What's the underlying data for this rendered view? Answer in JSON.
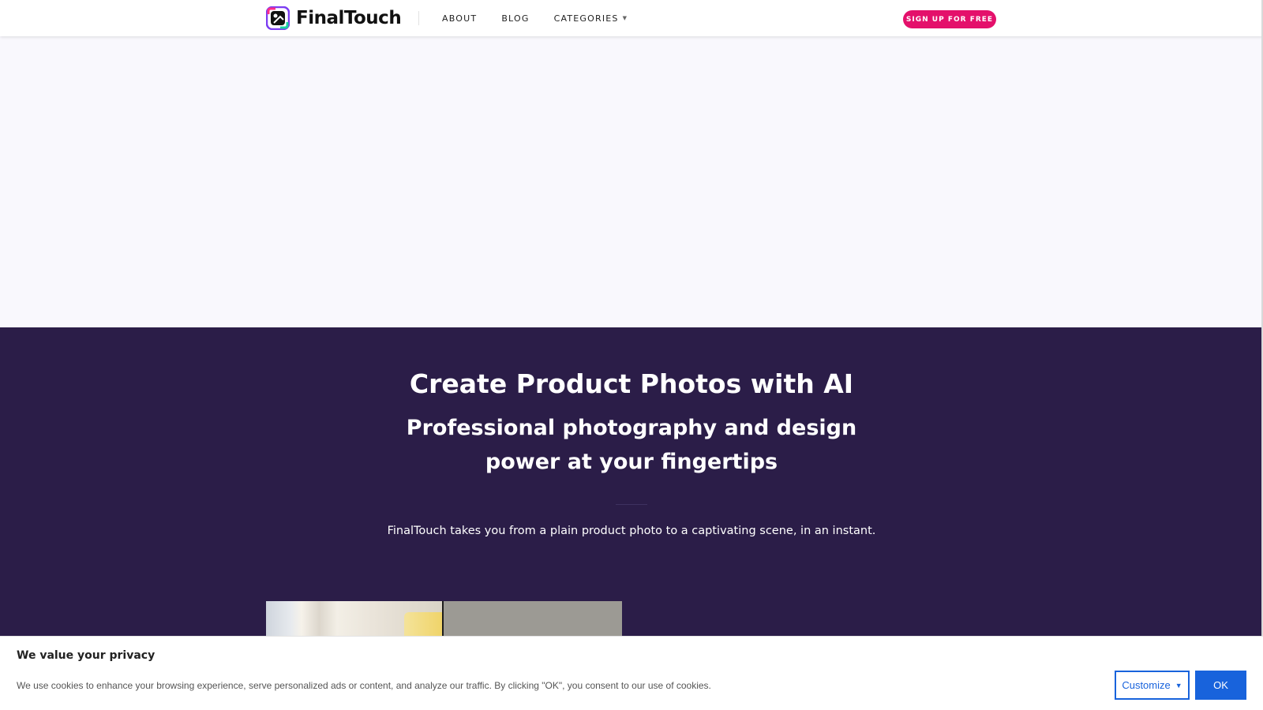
{
  "header": {
    "logo_text": "FinalTouch",
    "nav": [
      {
        "label": "ABOUT"
      },
      {
        "label": "BLOG"
      },
      {
        "label": "CATEGORIES"
      }
    ],
    "signup_label": "SIGN UP FOR FREE",
    "brand_color": "#e4106b"
  },
  "hero": {
    "title": "Create Product Photos with AI",
    "subtitle": "Professional photography and design power at your fingertips",
    "description": "FinalTouch takes you from a plain product photo to a captivating scene, in an instant.",
    "background_color": "#2b1d48"
  },
  "cookie_banner": {
    "title": "We value your privacy",
    "text": "We use cookies to enhance your browsing experience, serve personalized ads or content, and analyze our traffic. By clicking \"OK\", you consent to our use of cookies.",
    "customize_label": "Customize",
    "ok_label": "OK",
    "accent_color": "#1863dc"
  }
}
